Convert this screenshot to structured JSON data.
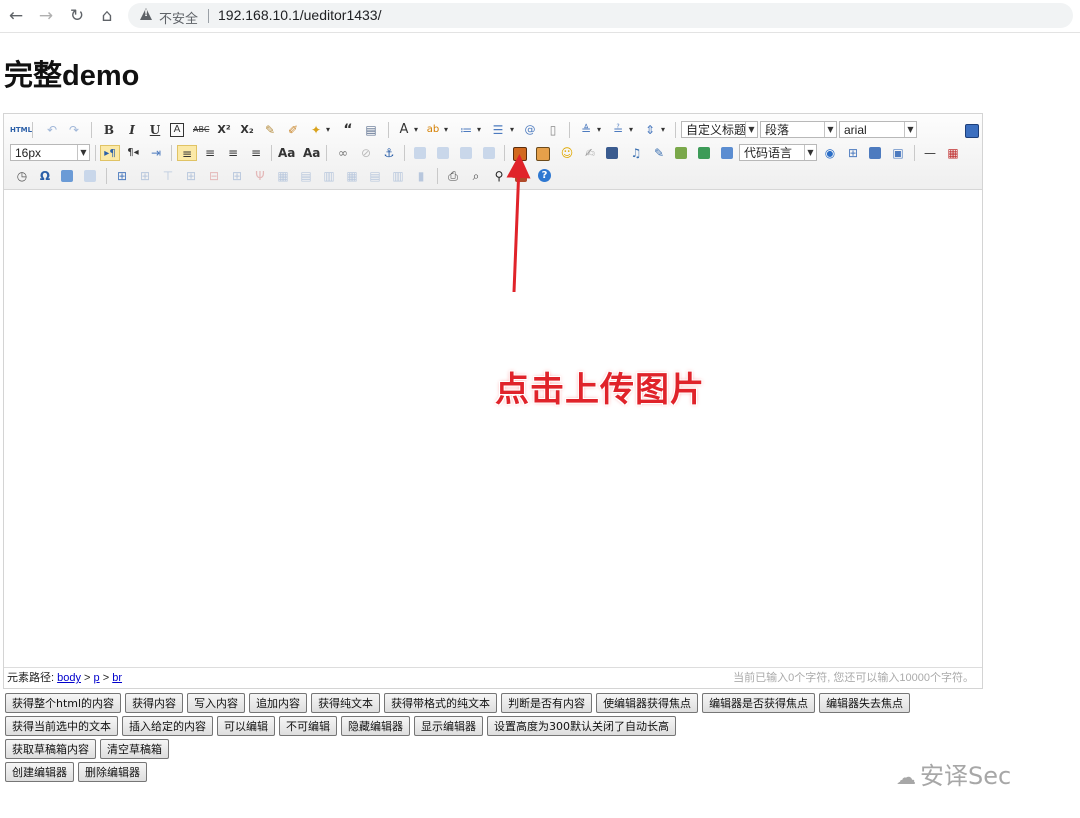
{
  "browser": {
    "insecure_label": "不安全",
    "url": "192.168.10.1/ueditor1433/"
  },
  "page": {
    "title": "完整demo"
  },
  "toolbar": {
    "font_size_value": "16px",
    "custom_heading_value": "自定义标题",
    "paragraph_value": "段落",
    "font_family_value": "arial",
    "code_language_value": "代码语言",
    "html_source_label": "HTML"
  },
  "annotation": {
    "text": "点击上传图片",
    "color": "#e0232a"
  },
  "statusbar": {
    "path_label": "元素路径:",
    "path_items": [
      "body",
      "p",
      "br"
    ],
    "path_sep": ">",
    "word_count": "当前已输入0个字符, 您还可以输入10000个字符。"
  },
  "buttons": {
    "row1": [
      "获得整个html的内容",
      "获得内容",
      "写入内容",
      "追加内容",
      "获得纯文本",
      "获得带格式的纯文本",
      "判断是否有内容",
      "使编辑器获得焦点",
      "编辑器是否获得焦点",
      "编辑器失去焦点"
    ],
    "row2": [
      "获得当前选中的文本",
      "插入给定的内容",
      "可以编辑",
      "不可编辑",
      "隐藏编辑器",
      "显示编辑器",
      "设置高度为300默认关闭了自动长高"
    ],
    "row3": [
      "获取草稿箱内容",
      "清空草稿箱"
    ],
    "row4": [
      "创建编辑器",
      "删除编辑器"
    ]
  },
  "watermark": {
    "text": "安译Sec"
  }
}
